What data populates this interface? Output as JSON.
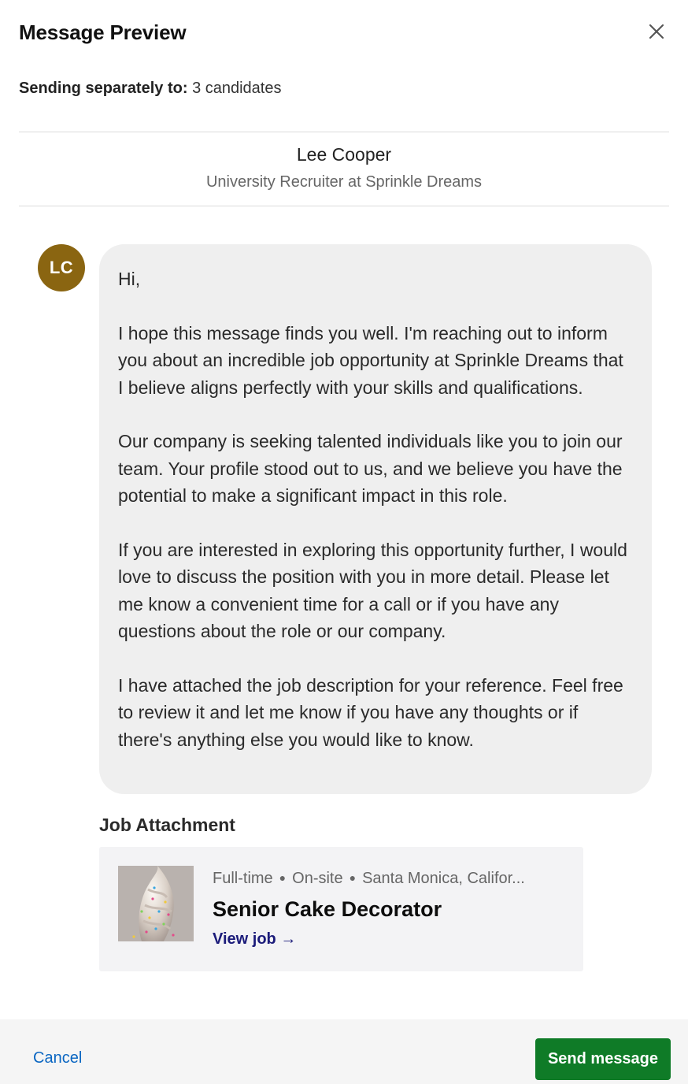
{
  "modal": {
    "title": "Message Preview"
  },
  "recipients": {
    "label": "Sending separately to:",
    "value": "3 candidates"
  },
  "sender": {
    "name": "Lee Cooper",
    "headline": "University Recruiter at Sprinkle Dreams",
    "initials": "LC",
    "avatar_color": "#8a6511"
  },
  "message": {
    "paragraphs": [
      "Hi,",
      "I hope this message finds you well. I'm reaching out to inform you about an incredible job opportunity at Sprinkle Dreams that I believe aligns perfectly with your skills and qualifications.",
      "Our company is seeking talented individuals like you to join our team. Your profile stood out to us, and we believe you have the potential to make a significant impact in this role.",
      "If you are interested in exploring this opportunity further, I would love to discuss the position with you in more detail. Please let me know a convenient time for a call or if you have any questions about the role or our company.",
      "I have attached the job description for your reference. Feel free to review it and let me know if you have any thoughts or if there's anything else you would like to know."
    ]
  },
  "attachment": {
    "label": "Job Attachment",
    "employment_type": "Full-time",
    "workplace": "On-site",
    "location": "Santa Monica, Califor...",
    "job_title": "Senior Cake Decorator",
    "view_link": "View job →"
  },
  "footer": {
    "cancel_label": "Cancel",
    "send_label": "Send message",
    "send_color": "#0f7b27",
    "cancel_color": "#0a66c2"
  },
  "icons": {
    "close": "close-icon"
  }
}
